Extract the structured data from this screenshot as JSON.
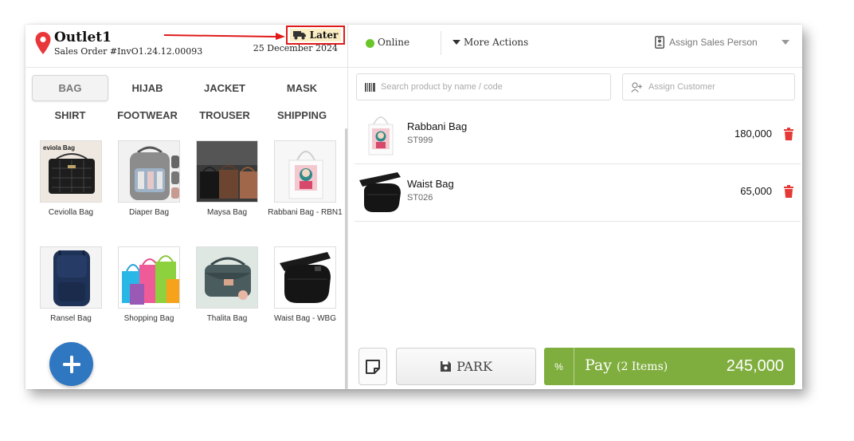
{
  "header": {
    "outlet_name": "Outlet1",
    "order_number": "Sales Order #InvO1.24.12.00093",
    "date": "25 December 2024",
    "later_label": "Later"
  },
  "categories": [
    {
      "label": "BAG",
      "active": true
    },
    {
      "label": "HIJAB"
    },
    {
      "label": "JACKET"
    },
    {
      "label": "MASK"
    },
    {
      "label": "SHIRT"
    },
    {
      "label": "FOOTWEAR"
    },
    {
      "label": "TROUSER"
    },
    {
      "label": "SHIPPING"
    }
  ],
  "products": [
    {
      "name": "Ceviolla Bag",
      "thumb_text": "eviola Bag"
    },
    {
      "name": "Diaper Bag"
    },
    {
      "name": "Maysa Bag"
    },
    {
      "name": "Rabbani Bag - RBN1"
    },
    {
      "name": "Ransel Bag"
    },
    {
      "name": "Shopping Bag"
    },
    {
      "name": "Thalita Bag"
    },
    {
      "name": "Waist Bag - WBG"
    }
  ],
  "topbar": {
    "status": "Online",
    "status_color": "#6ac52a",
    "more_actions": "More Actions",
    "assign_sales": "Assign Sales Person"
  },
  "search": {
    "placeholder": "Search product by name / code",
    "assign_customer": "Assign Customer"
  },
  "cart": [
    {
      "name": "Rabbani Bag",
      "code": "ST999",
      "price": "180,000"
    },
    {
      "name": "Waist Bag",
      "code": "ST026",
      "price": "65,000"
    }
  ],
  "footer": {
    "park_label": "PARK",
    "pct_label": "%",
    "pay_label": "Pay",
    "pay_count": "(2 Items)",
    "total": "245,000",
    "pay_color": "#7fae3e"
  }
}
